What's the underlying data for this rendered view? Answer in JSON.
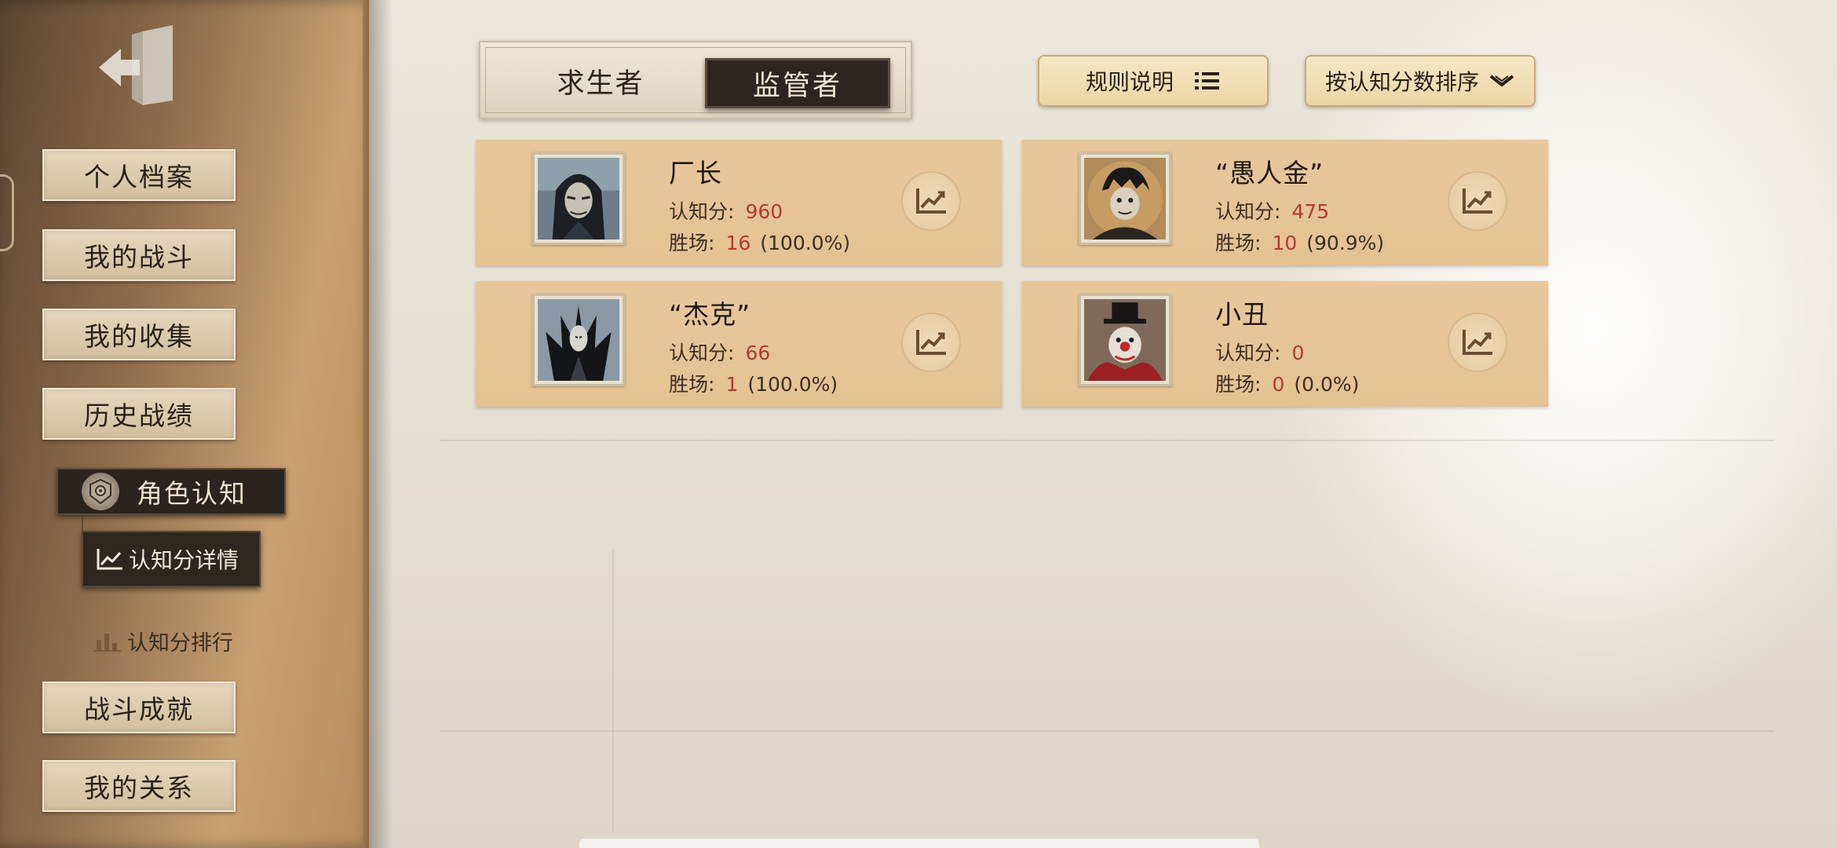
{
  "sidebar": {
    "exit_icon": "exit-door-icon",
    "items": [
      {
        "label": "个人档案"
      },
      {
        "label": "我的战斗"
      },
      {
        "label": "我的收集"
      },
      {
        "label": "历史战绩"
      }
    ],
    "active_item": {
      "label": "角色认知",
      "icon": "emblem-badge-icon"
    },
    "sub_items": [
      {
        "label": "认知分详情",
        "icon": "line-chart-icon",
        "active": true
      },
      {
        "label": "认知分排行",
        "icon": "ranking-bars-icon",
        "active": false
      }
    ],
    "items_bottom": [
      {
        "label": "战斗成就"
      },
      {
        "label": "我的关系"
      }
    ]
  },
  "toggle": {
    "survivor_label": "求生者",
    "hunter_label": "监管者",
    "selected": "监管者"
  },
  "toolbar": {
    "rules_label": "规则说明",
    "rules_icon": "list-icon",
    "sort_label": "按认知分数排序",
    "sort_icon": "chevron-down-icon"
  },
  "cards": [
    {
      "name": "厂长",
      "score_label": "认知分:",
      "score": "960",
      "wins_label": "胜场:",
      "wins": "16",
      "rate": "(100.0%)",
      "chart_icon": "trend-chart-icon"
    },
    {
      "name": "“愚人金”",
      "score_label": "认知分:",
      "score": "475",
      "wins_label": "胜场:",
      "wins": "10",
      "rate": "(90.9%)",
      "chart_icon": "trend-chart-icon"
    },
    {
      "name": "“杰克”",
      "score_label": "认知分:",
      "score": "66",
      "wins_label": "胜场:",
      "wins": "1",
      "rate": "(100.0%)",
      "chart_icon": "trend-chart-icon"
    },
    {
      "name": "小丑",
      "score_label": "认知分:",
      "score": "0",
      "wins_label": "胜场:",
      "wins": "0",
      "rate": "(0.0%)",
      "chart_icon": "trend-chart-icon"
    }
  ],
  "colors": {
    "card_bg": "#e6c699",
    "value_red": "#b03a33",
    "dark_button": "#2c2520"
  }
}
